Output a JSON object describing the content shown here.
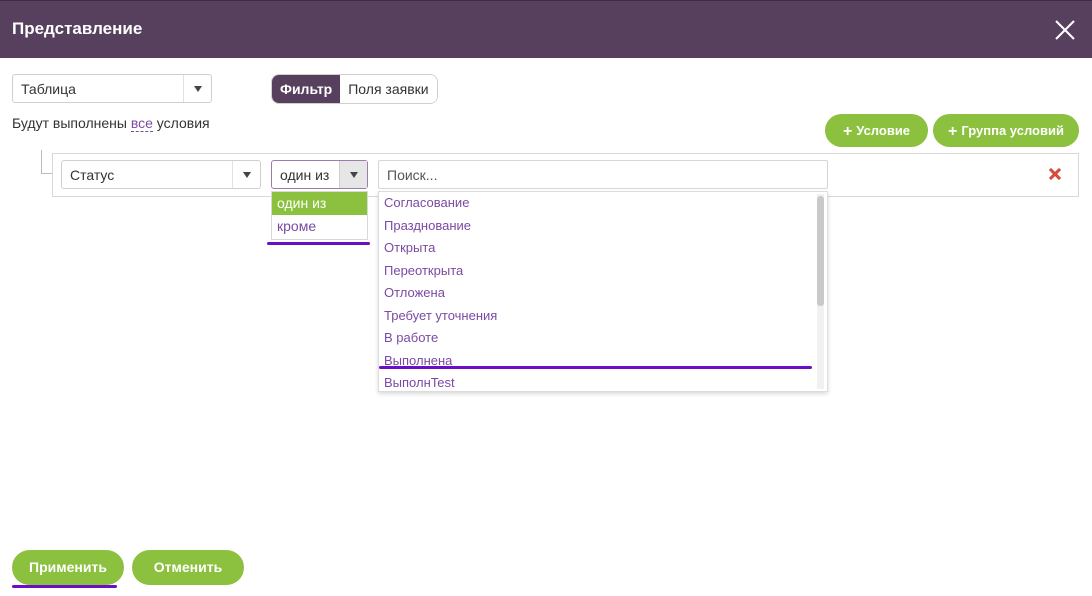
{
  "header": {
    "title": "Представление"
  },
  "view_select": {
    "value": "Таблица"
  },
  "tabs": [
    {
      "label": "Фильтр",
      "active": true
    },
    {
      "label": "Поля заявки",
      "active": false
    }
  ],
  "conditions_text": {
    "prefix": "Будут выполнены ",
    "link": "все",
    "suffix": " условия"
  },
  "buttons": {
    "add_condition": "Условие",
    "add_group": "Группа условий",
    "apply": "Применить",
    "cancel": "Отменить"
  },
  "condition": {
    "field": "Статус",
    "operator": "один из",
    "search_placeholder": "Поиск..."
  },
  "operator_options": [
    "один из",
    "кроме"
  ],
  "status_options": [
    "Согласование",
    "Празднование",
    "Открыта",
    "Переоткрыта",
    "Отложена",
    "Требует уточнения",
    "В работе",
    "Выполнена",
    "ВыполнTest"
  ],
  "colors": {
    "header_bg": "#56405e",
    "accent_green": "#8cc13f",
    "link_purple": "#7a4aa3",
    "highlight_underline": "#6a0fc7"
  }
}
